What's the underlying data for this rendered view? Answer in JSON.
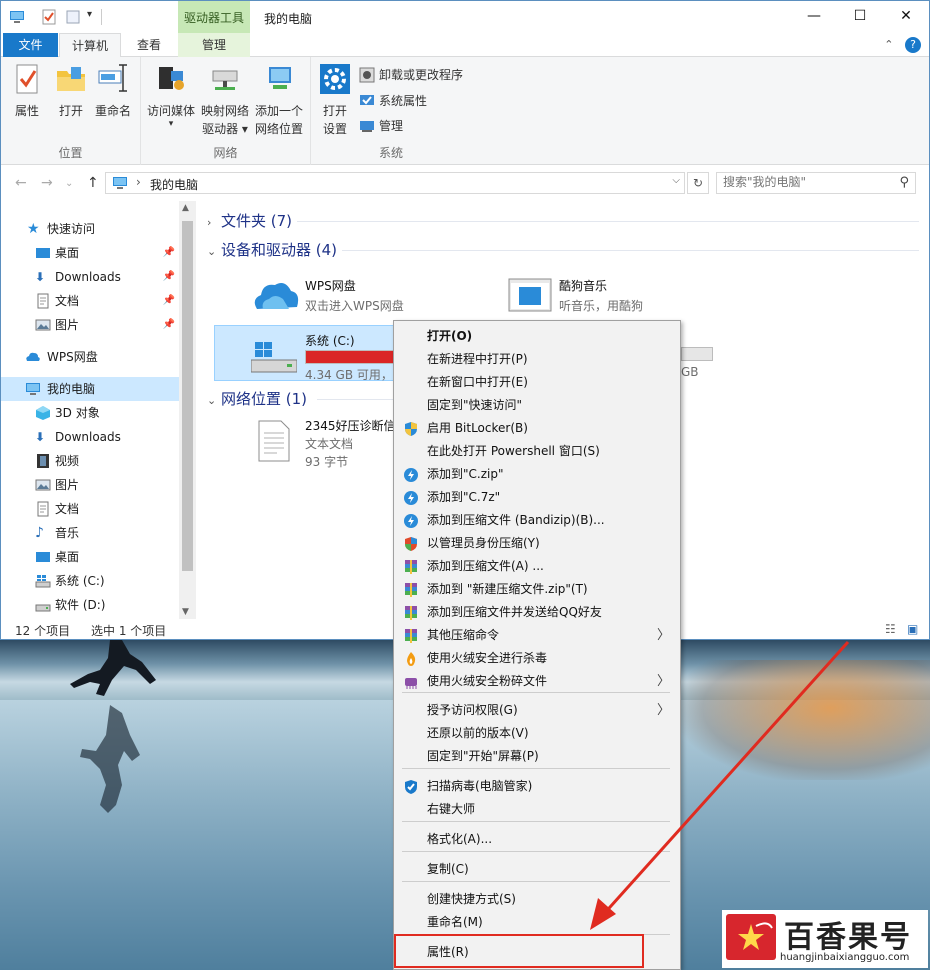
{
  "window": {
    "title": "我的电脑",
    "context_tab_header": "驱动器工具",
    "controls": {
      "minimize": "—",
      "maximize": "☐",
      "close": "✕",
      "help": "?"
    }
  },
  "ribbon": {
    "tabs": [
      "文件",
      "计算机",
      "查看",
      "管理"
    ],
    "groups": {
      "location": {
        "label": "位置",
        "buttons": [
          "属性",
          "打开",
          "重命名"
        ]
      },
      "network": {
        "label": "网络",
        "buttons": [
          {
            "line1": "访问媒体",
            "line2": "▾"
          },
          {
            "line1": "映射网络",
            "line2": "驱动器 ▾"
          },
          {
            "line1": "添加一个",
            "line2": "网络位置"
          }
        ]
      },
      "system": {
        "label": "系统",
        "open_settings": {
          "line1": "打开",
          "line2": "设置"
        },
        "small": [
          "卸载或更改程序",
          "系统属性",
          "管理"
        ]
      }
    }
  },
  "address": {
    "path": "我的电脑",
    "search_placeholder": "搜索\"我的电脑\""
  },
  "nav": {
    "quick_access": "快速访问",
    "quick_items": [
      "桌面",
      "Downloads",
      "文档",
      "图片"
    ],
    "wps": "WPS网盘",
    "my_pc": "我的电脑",
    "pc_items": [
      "3D 对象",
      "Downloads",
      "视频",
      "图片",
      "文档",
      "音乐",
      "桌面",
      "系统 (C:)",
      "软件 (D:)"
    ]
  },
  "content": {
    "folders_group": "文件夹 (7)",
    "devices_group": "设备和驱动器 (4)",
    "network_group": "网络位置 (1)",
    "devices": [
      {
        "name": "WPS网盘",
        "sub": "双击进入WPS网盘"
      },
      {
        "name": "酷狗音乐",
        "sub": "听音乐，用酷狗"
      },
      {
        "name": "系统 (C:)",
        "sub": "4.34 GB 可用，共",
        "used_fraction": 0.97
      },
      {
        "sub": "GB",
        "used_fraction": 0.0
      }
    ],
    "network_items": [
      {
        "name": "2345好压诊断信",
        "type": "文本文档",
        "size": "93 字节"
      }
    ]
  },
  "status": {
    "count": "12 个项目",
    "selected": "选中 1 个项目"
  },
  "context_menu": {
    "items": [
      {
        "label": "打开(O)",
        "bold": true
      },
      {
        "label": "在新进程中打开(P)"
      },
      {
        "label": "在新窗口中打开(E)"
      },
      {
        "label": "固定到\"快速访问\""
      },
      {
        "label": "启用 BitLocker(B)",
        "icon": "shield-uac-icon"
      },
      {
        "label": "在此处打开 Powershell 窗口(S)"
      },
      {
        "label": "添加到\"C.zip\"",
        "icon": "bandizip-icon"
      },
      {
        "label": "添加到\"C.7z\"",
        "icon": "bandizip-icon"
      },
      {
        "label": "添加到压缩文件 (Bandizip)(B)...",
        "icon": "bandizip-icon"
      },
      {
        "label": "以管理员身份压缩(Y)",
        "icon": "shield-color-icon"
      },
      {
        "label": "添加到压缩文件(A) ...",
        "icon": "winrar-icon"
      },
      {
        "label": "添加到 \"新建压缩文件.zip\"(T)",
        "icon": "winrar-icon"
      },
      {
        "label": "添加到压缩文件并发送给QQ好友",
        "icon": "winrar-icon"
      },
      {
        "label": "其他压缩命令",
        "icon": "winrar-icon",
        "submenu": true
      },
      {
        "label": "使用火绒安全进行杀毒",
        "icon": "huorong-icon"
      },
      {
        "label": "使用火绒安全粉碎文件",
        "icon": "shredder-icon",
        "submenu": true
      },
      {
        "label": "授予访问权限(G)",
        "submenu": true
      },
      {
        "label": "还原以前的版本(V)"
      },
      {
        "label": "固定到\"开始\"屏幕(P)"
      },
      {
        "label": "扫描病毒(电脑管家)",
        "icon": "tencent-shield-icon"
      },
      {
        "label": "右键大师"
      },
      {
        "label": "格式化(A)..."
      },
      {
        "label": "复制(C)"
      },
      {
        "label": "创建快捷方式(S)"
      },
      {
        "label": "重命名(M)"
      },
      {
        "label": "属性(R)"
      }
    ],
    "submenu_glyph": "〉"
  },
  "watermark": {
    "name": "百香果号",
    "url": "huangjinbaixiangguo.com"
  },
  "colors": {
    "accent": "#1979ca",
    "highlight": "#e02b20",
    "drive_bar": "#da2626",
    "selection": "#cce8ff"
  }
}
